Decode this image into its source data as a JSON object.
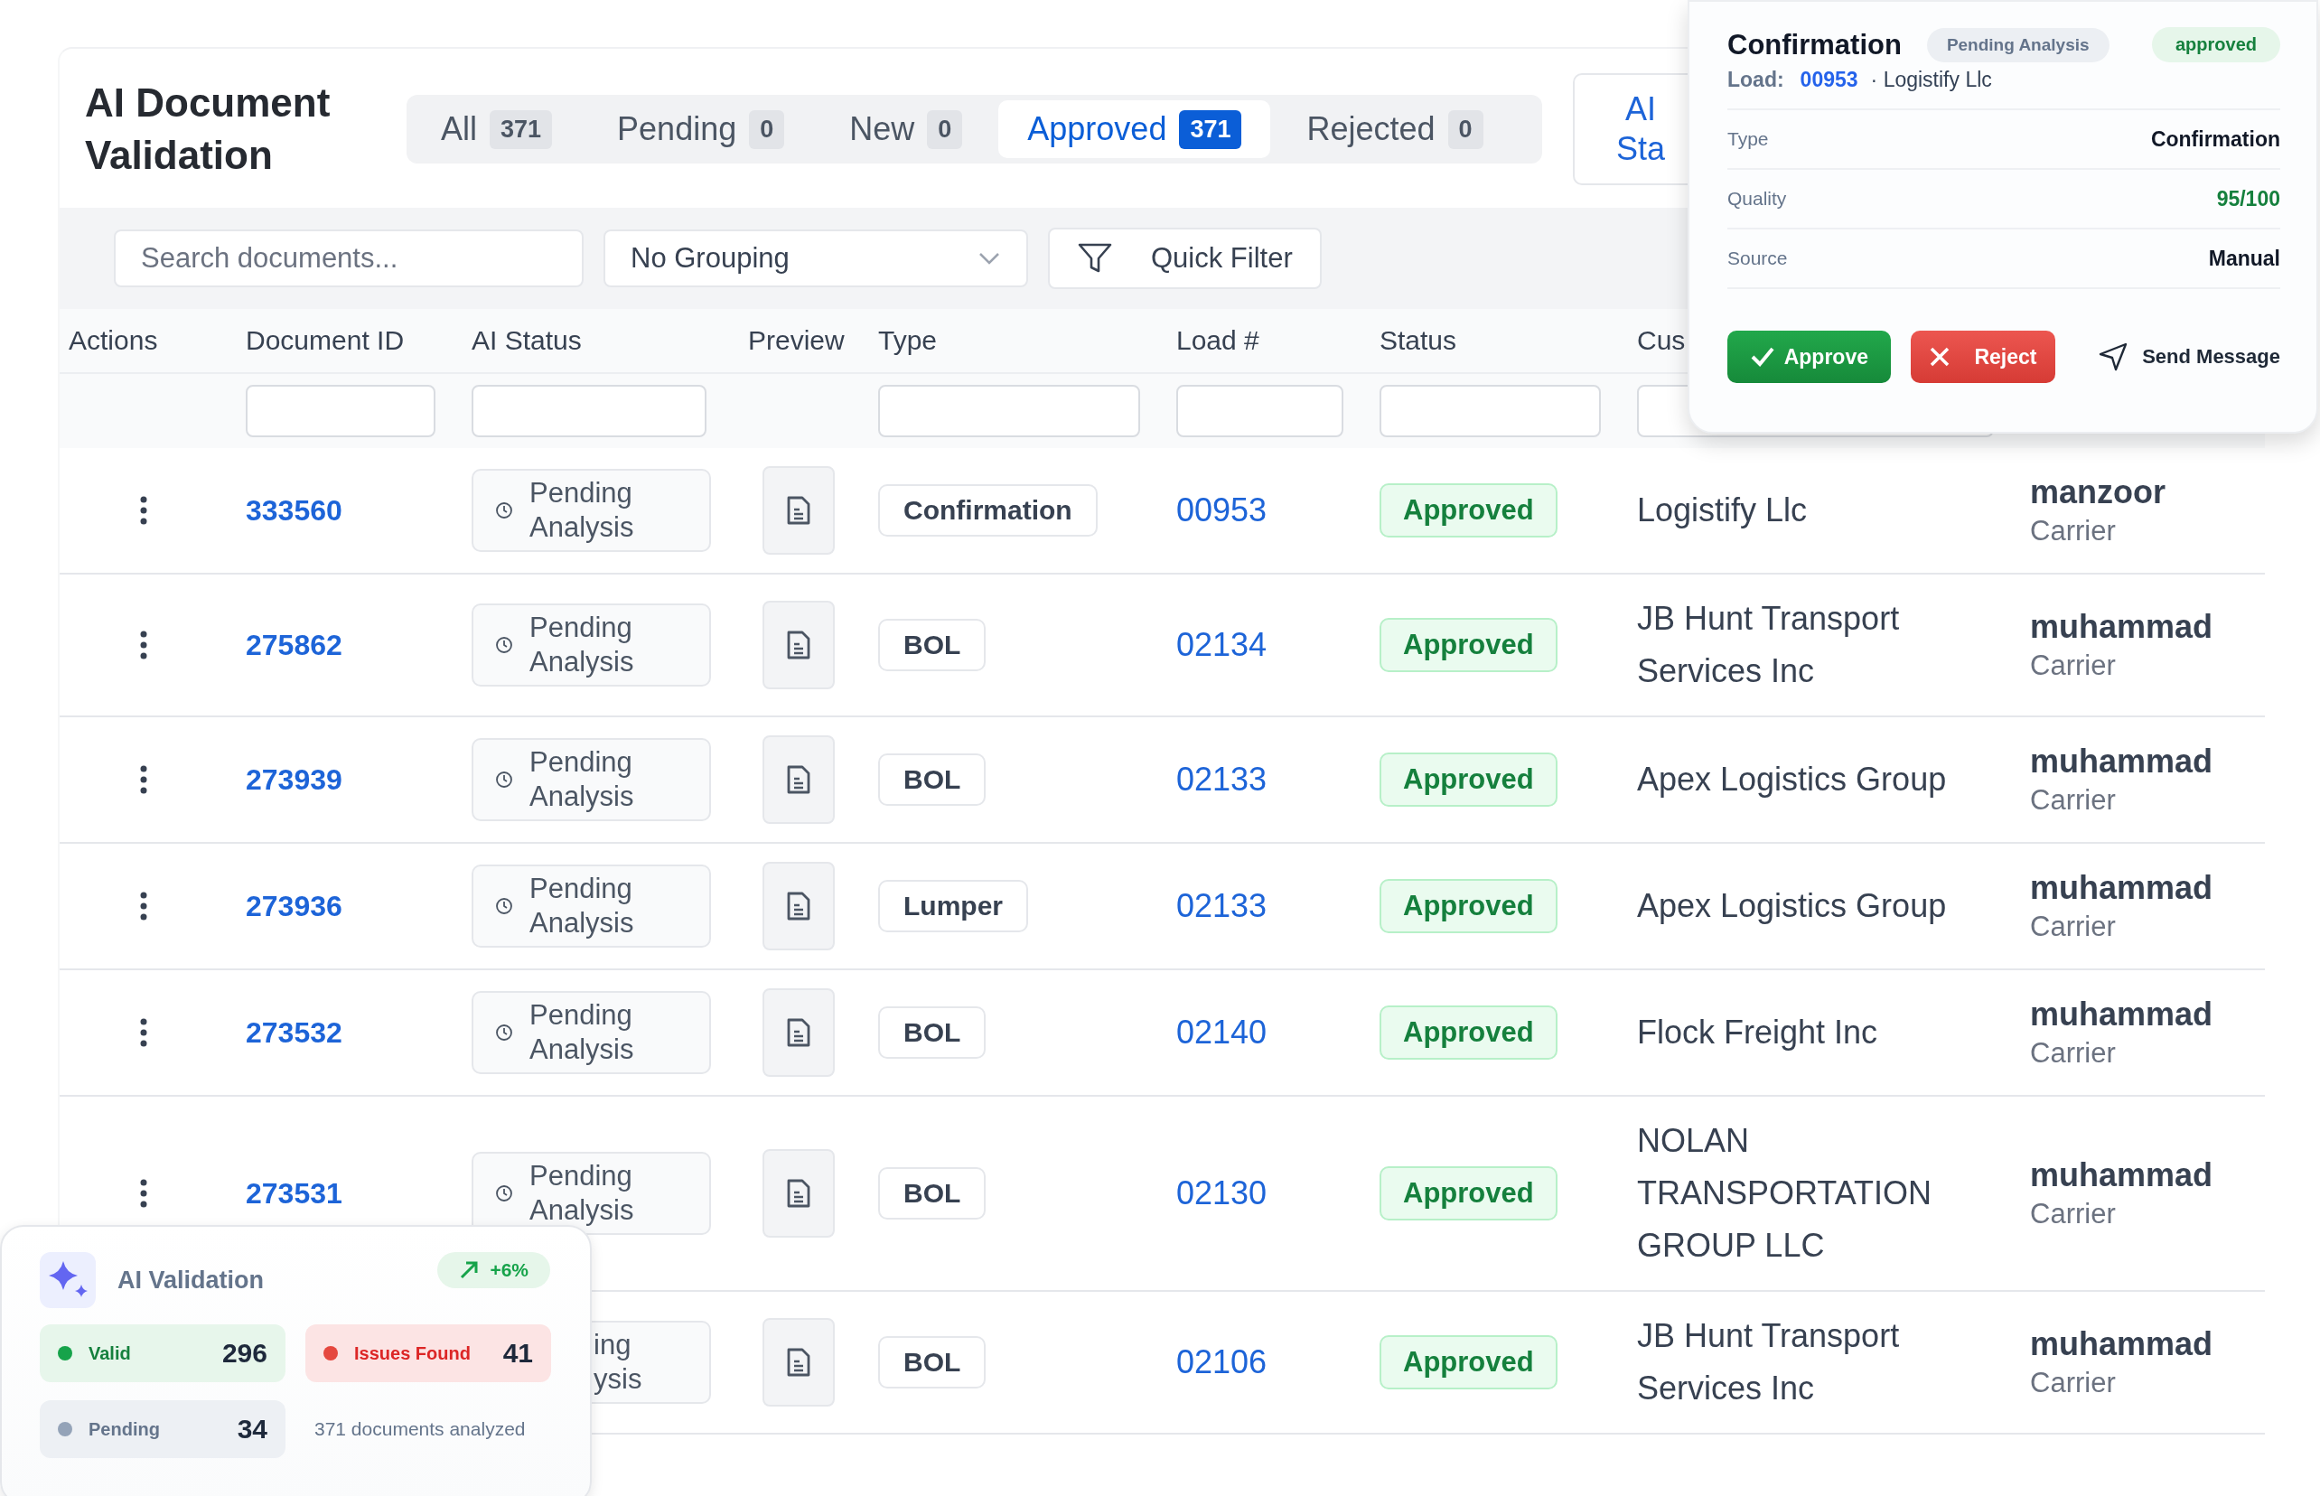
{
  "title": "AI Document Validation",
  "tabs": [
    {
      "label": "All",
      "count": "371",
      "selected": false
    },
    {
      "label": "Pending",
      "count": "0",
      "selected": false
    },
    {
      "label": "New",
      "count": "0",
      "selected": false
    },
    {
      "label": "Approved",
      "count": "371",
      "selected": true
    },
    {
      "label": "Rejected",
      "count": "0",
      "selected": false
    }
  ],
  "side_button": {
    "label": "AI Sta"
  },
  "toolbar": {
    "search": {
      "placeholder": "Search documents..."
    },
    "grouping": {
      "value": "No Grouping"
    },
    "quick_filter": {
      "label": "Quick Filter"
    }
  },
  "table": {
    "columns": [
      "Actions",
      "Document ID",
      "AI Status",
      "Preview",
      "Type",
      "Load #",
      "Status",
      "Cus"
    ],
    "rows": [
      {
        "document_id": "333560",
        "ai_status": "Pending Analysis",
        "type": "Confirmation",
        "load": "00953",
        "status": "Approved",
        "customer": "Logistify Llc",
        "user": "manzoor",
        "role": "Carrier"
      },
      {
        "document_id": "275862",
        "ai_status": "Pending Analysis",
        "type": "BOL",
        "load": "02134",
        "status": "Approved",
        "customer": "JB Hunt Transport Services Inc",
        "user": "muhammad",
        "role": "Carrier"
      },
      {
        "document_id": "273939",
        "ai_status": "Pending Analysis",
        "type": "BOL",
        "load": "02133",
        "status": "Approved",
        "customer": "Apex Logistics Group",
        "user": "muhammad",
        "role": "Carrier"
      },
      {
        "document_id": "273936",
        "ai_status": "Pending Analysis",
        "type": "Lumper",
        "load": "02133",
        "status": "Approved",
        "customer": "Apex Logistics Group",
        "user": "muhammad",
        "role": "Carrier"
      },
      {
        "document_id": "273532",
        "ai_status": "Pending Analysis",
        "type": "BOL",
        "load": "02140",
        "status": "Approved",
        "customer": "Flock Freight Inc",
        "user": "muhammad",
        "role": "Carrier"
      },
      {
        "document_id": "273531",
        "ai_status": "Pending Analysis",
        "type": "BOL",
        "load": "02130",
        "status": "Approved",
        "customer": "NOLAN TRANSPORTATION GROUP LLC",
        "user": "muhammad",
        "role": "Carrier"
      },
      {
        "ai_status": "ing ysis",
        "ai_status_cut": true,
        "type": "BOL",
        "load": "02106",
        "status": "Approved",
        "customer": "JB Hunt Transport Services Inc",
        "user": "muhammad",
        "role": "Carrier"
      }
    ]
  },
  "popup": {
    "title": "Confirmation",
    "ai_badge": "Pending Analysis",
    "status_badge": "approved",
    "load_label": "Load:",
    "load": "00953",
    "customer": "· Logistify Llc",
    "details": [
      {
        "label": "Type",
        "value": "Confirmation",
        "kind": "plain"
      },
      {
        "label": "Quality",
        "value": "95/100",
        "kind": "good"
      },
      {
        "label": "Source",
        "value": "Manual",
        "kind": "plain"
      }
    ],
    "approve": "Approve",
    "reject": "Reject",
    "send": "Send Message"
  },
  "summary_card": {
    "title": "AI Validation",
    "trend": "+6%",
    "stats": [
      {
        "label": "Valid",
        "value": "296",
        "kind": "valid",
        "color": "#16a34a"
      },
      {
        "label": "Issues Found",
        "value": "41",
        "kind": "issues",
        "color": "#e5483f"
      },
      {
        "label": "Pending",
        "value": "34",
        "kind": "pending",
        "color": "#94a3b8"
      }
    ],
    "note": "371 documents analyzed"
  }
}
